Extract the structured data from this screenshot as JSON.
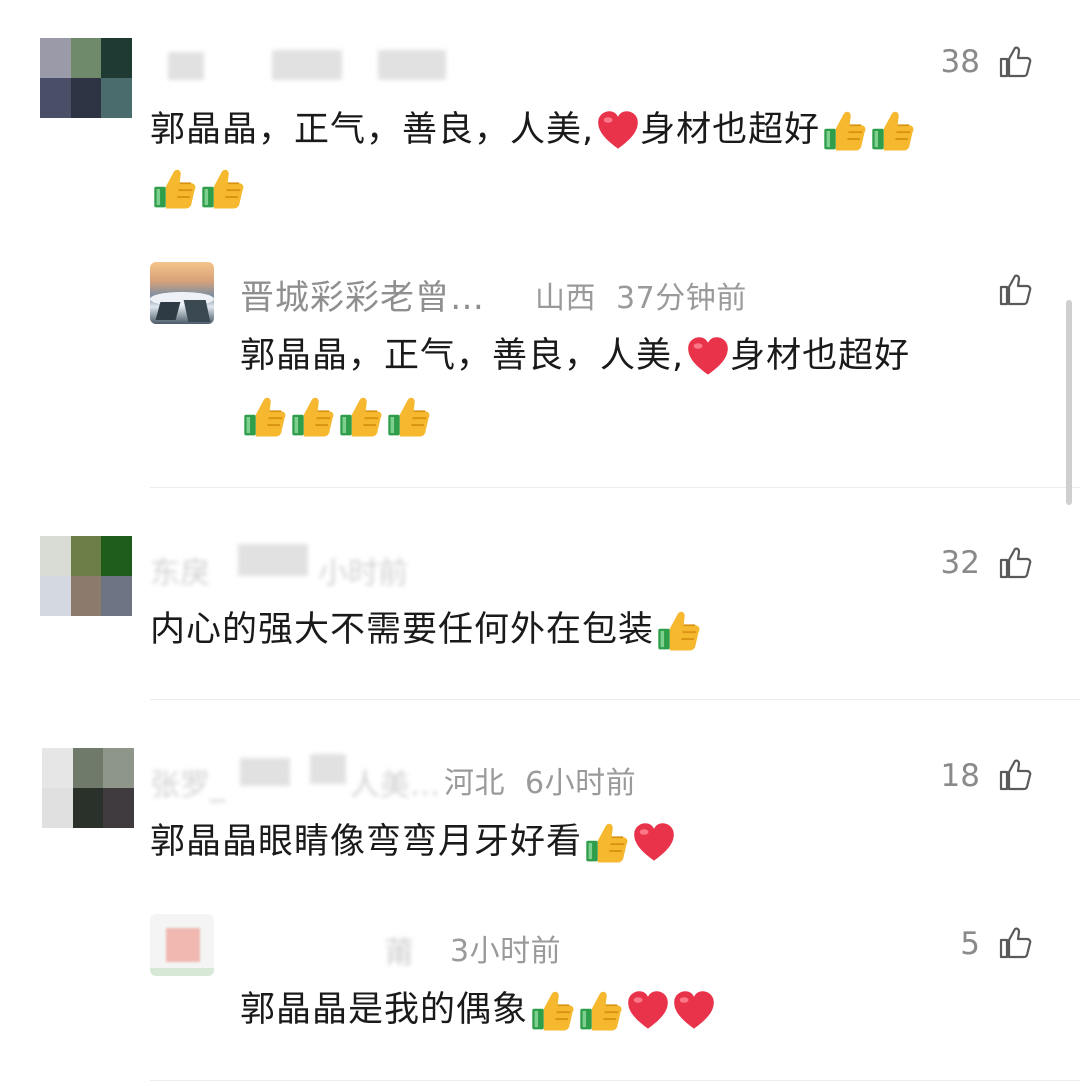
{
  "comments": [
    {
      "likes": "38",
      "text_line1": "郭晶晶，正气，善良，人美,",
      "text_line1b": "身材也超好",
      "reply": {
        "username": "晋城彩彩老曾…",
        "location": "山西",
        "time": "37分钟前",
        "text_line1": "郭晶晶，正气，善良，人美,",
        "text_line1b": "身材也超好"
      }
    },
    {
      "likes": "32",
      "text": "内心的强大不需要任何外在包装"
    },
    {
      "likes": "18",
      "location": "河北",
      "time": "6小时前",
      "text": "郭晶晶眼睛像弯弯月牙好看",
      "reply": {
        "likes": "5",
        "time": "3小时前",
        "text": "郭晶晶是我的偶象"
      }
    }
  ],
  "colors": {
    "text": "#1a1a1a",
    "meta": "#9a9a9a",
    "heart": "#e8334a",
    "thumb": "#f5b82e",
    "sleeve": "#2e9e4b"
  }
}
